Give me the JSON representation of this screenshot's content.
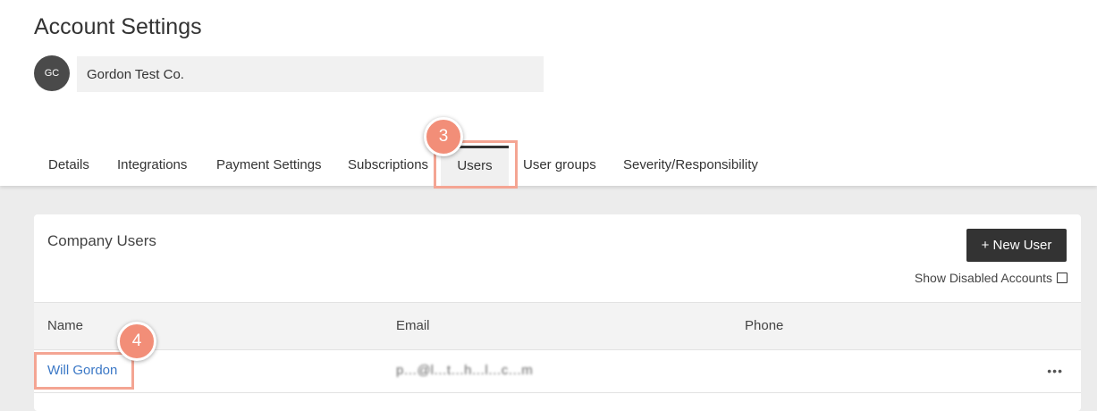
{
  "header": {
    "title": "Account Settings",
    "avatar_initials": "GC",
    "company_name": "Gordon Test Co."
  },
  "tabs": [
    {
      "label": "Details",
      "active": false
    },
    {
      "label": "Integrations",
      "active": false
    },
    {
      "label": "Payment Settings",
      "active": false
    },
    {
      "label": "Subscriptions",
      "active": false
    },
    {
      "label": "Users",
      "active": true
    },
    {
      "label": "User groups",
      "active": false
    },
    {
      "label": "Severity/Responsibility",
      "active": false
    }
  ],
  "callouts": {
    "tab_step": "3",
    "user_step": "4",
    "color": "#f28e78"
  },
  "users_panel": {
    "title": "Company Users",
    "new_user_label": "+ New User",
    "show_disabled_label": "Show Disabled Accounts",
    "show_disabled_checked": false,
    "columns": [
      "Name",
      "Email",
      "Phone"
    ],
    "rows": [
      {
        "name": "Will Gordon",
        "email": "p…@l…t…h…l…c…m",
        "phone": "",
        "more_icon": "more-horizontal-icon"
      }
    ]
  }
}
